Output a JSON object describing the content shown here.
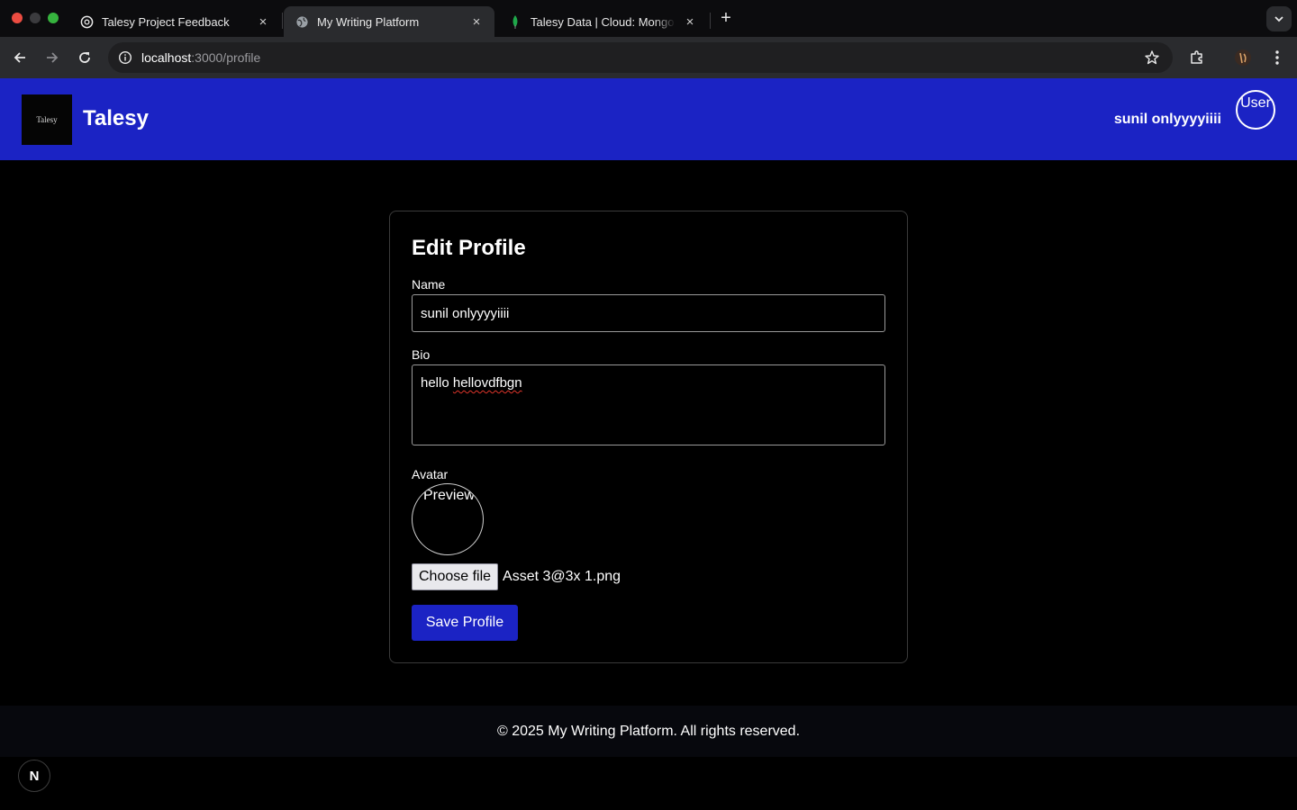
{
  "browser": {
    "tabs": [
      {
        "title": "Talesy Project Feedback",
        "icon": "openai-icon",
        "active": false
      },
      {
        "title": "My Writing Platform",
        "icon": "globe-icon",
        "active": true
      },
      {
        "title": "Talesy Data | Cloud: MongoDB",
        "icon": "mongodb-leaf-icon",
        "active": false
      }
    ],
    "close_glyph": "×",
    "new_tab_glyph": "+",
    "url_host": "localhost",
    "url_rest": ":3000/profile"
  },
  "header": {
    "logo_text": "Talesy",
    "brand": "Talesy",
    "user_name": "sunil onlyyyyiiii",
    "avatar_alt": "User"
  },
  "form": {
    "title": "Edit Profile",
    "name_label": "Name",
    "name_value": "sunil onlyyyyiiii",
    "bio_label": "Bio",
    "bio_word1": "hello",
    "bio_word2": "hellovdfbgn",
    "avatar_label": "Avatar",
    "avatar_preview_alt": "Preview",
    "choose_file_label": "Choose file",
    "file_name": "Asset 3@3x 1.png",
    "save_label": "Save Profile"
  },
  "footer": {
    "text": "© 2025 My Writing Platform. All rights reserved."
  },
  "dev_badge": "N",
  "colors": {
    "header_bg": "#1b23c4",
    "button_bg": "#1b23c4",
    "page_bg": "#000000"
  }
}
